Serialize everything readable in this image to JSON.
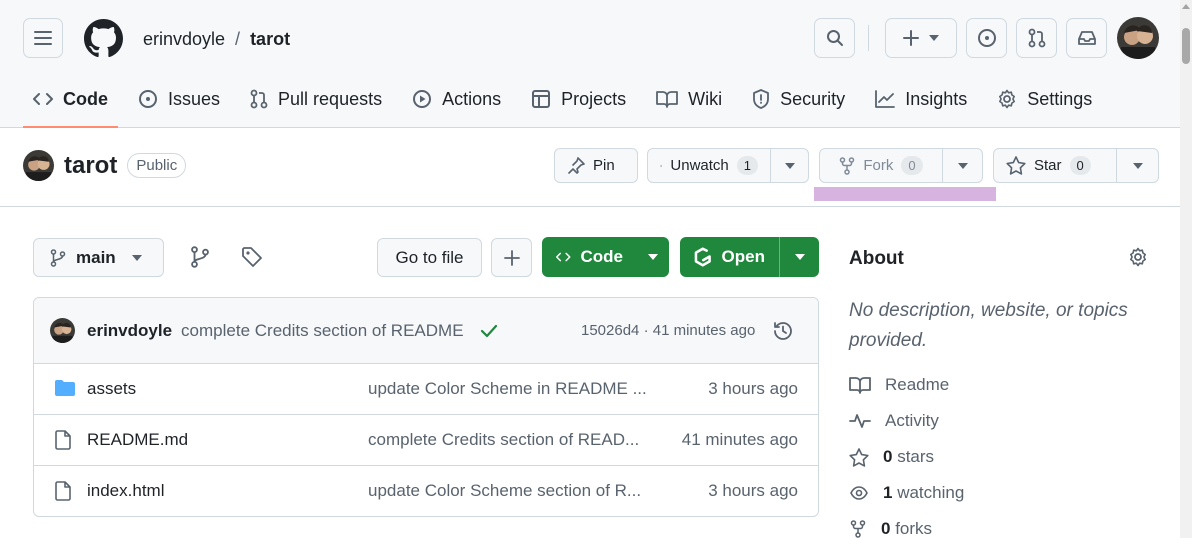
{
  "header": {
    "owner": "erinvdoyle",
    "separator": "/",
    "repo": "tarot"
  },
  "tabs": [
    {
      "label": "Code",
      "icon": "code-icon",
      "active": true
    },
    {
      "label": "Issues",
      "icon": "issue-icon"
    },
    {
      "label": "Pull requests",
      "icon": "pull-request-icon"
    },
    {
      "label": "Actions",
      "icon": "play-icon"
    },
    {
      "label": "Projects",
      "icon": "table-icon"
    },
    {
      "label": "Wiki",
      "icon": "book-icon"
    },
    {
      "label": "Security",
      "icon": "shield-icon"
    },
    {
      "label": "Insights",
      "icon": "graph-icon"
    },
    {
      "label": "Settings",
      "icon": "gear-icon"
    }
  ],
  "repo_header": {
    "name": "tarot",
    "visibility": "Public",
    "pin_label": "Pin",
    "watch_label": "Unwatch",
    "watch_count": "1",
    "fork_label": "Fork",
    "fork_count": "0",
    "star_label": "Star",
    "star_count": "0"
  },
  "toolbar": {
    "branch": "main",
    "go_to_file": "Go to file",
    "code_label": "Code",
    "open_label": "Open"
  },
  "latest_commit": {
    "author": "erinvdoyle",
    "message": "complete Credits section of README",
    "meta": "15026d4 · 41 minutes ago"
  },
  "files": [
    {
      "name": "assets",
      "type": "folder",
      "commit": "update Color Scheme in README ...",
      "age": "3 hours ago"
    },
    {
      "name": "README.md",
      "type": "file",
      "commit": "complete Credits section of READ...",
      "age": "41 minutes ago"
    },
    {
      "name": "index.html",
      "type": "file",
      "commit": "update Color Scheme section of R...",
      "age": "3 hours ago"
    }
  ],
  "about": {
    "title": "About",
    "description": "No description, website, or topics provided.",
    "readme": "Readme",
    "activity": "Activity",
    "stars_count": "0",
    "stars_label": "stars",
    "watching_count": "1",
    "watching_label": "watching",
    "forks_count": "0",
    "forks_label": "forks"
  },
  "colors": {
    "primary_green": "#1f883d",
    "active_tab_underline": "#fd8c73",
    "highlight": "#c99ad6",
    "folder": "#54aeff"
  }
}
